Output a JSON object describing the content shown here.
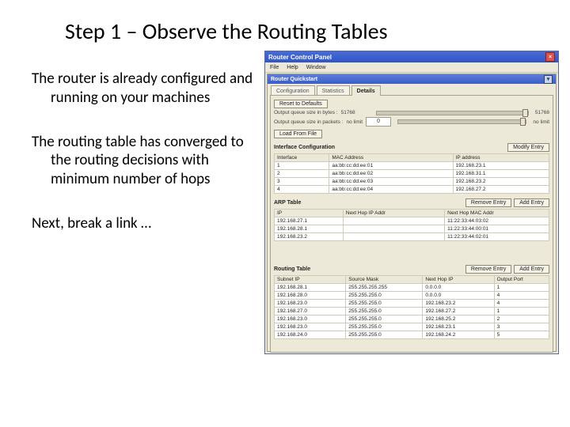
{
  "slide": {
    "title": "Step 1 – Observe the Routing Tables",
    "para1": "The router is already configured and running on your machines",
    "para2": "The routing table has converged to the routing decisions with minimum number of hops",
    "para3": "Next, break a link …"
  },
  "win": {
    "title": "Router Control Panel",
    "menu": {
      "file": "File",
      "help": "Help",
      "window": "Window"
    },
    "panel_title": "Router Quickstart",
    "tabs": {
      "t1": "Configuration",
      "t2": "Statistics",
      "t3": "Details"
    },
    "buttons": {
      "reset": "Reset to Defaults",
      "load": "Load From File",
      "modify": "Modify Entry",
      "remove": "Remove Entry",
      "add": "Add Entry"
    },
    "queue": {
      "label1": "Output queue size in bytes :",
      "val1": "51768",
      "right1": "51768",
      "label2": "Output queue size in packets :",
      "val2": "no limit",
      "right2": "no limit",
      "slider2_input": "0"
    },
    "iface": {
      "heading": "Interface Configuration",
      "h1": "Interface",
      "h2": "MAC Address",
      "h3": "IP address",
      "rows": [
        {
          "a": "1",
          "b": "aa:bb:cc:dd:ee:01",
          "c": "192.168.23.1"
        },
        {
          "a": "2",
          "b": "aa:bb:cc:dd:ee:02",
          "c": "192.168.31.1"
        },
        {
          "a": "3",
          "b": "aa:bb:cc:dd:ee:03",
          "c": "192.168.23.2"
        },
        {
          "a": "4",
          "b": "aa:bb:cc:dd:ee:04",
          "c": "192.168.27.2"
        }
      ]
    },
    "arp": {
      "heading": "ARP Table",
      "h1": "IP",
      "h2": "Next Hop IP Addr",
      "h3": "Next Hop MAC Addr",
      "rows": [
        {
          "a": "192.168.27.1",
          "b": "",
          "c": "11:22:33:44:03:02"
        },
        {
          "a": "192.168.28.1",
          "b": "",
          "c": "11:22:33:44:00:01"
        },
        {
          "a": "192.168.23.2",
          "b": "",
          "c": "11:22:33:44:02:01"
        }
      ]
    },
    "rt": {
      "heading": "Routing Table",
      "h1": "Subnet IP",
      "h2": "Source Mask",
      "h3": "Next Hop IP",
      "h4": "Output Port",
      "rows": [
        {
          "a": "192.168.28.1",
          "b": "255.255.255.255",
          "c": "0.0.0.0",
          "d": "1"
        },
        {
          "a": "192.168.28.0",
          "b": "255.255.255.0",
          "c": "0.0.0.0",
          "d": "4"
        },
        {
          "a": "192.168.23.0",
          "b": "255.255.255.0",
          "c": "192.168.23.2",
          "d": "4"
        },
        {
          "a": "192.168.27.0",
          "b": "255.255.255.0",
          "c": "192.168.27.2",
          "d": "1"
        },
        {
          "a": "192.168.23.0",
          "b": "255.255.255.0",
          "c": "192.168.25.2",
          "d": "2"
        },
        {
          "a": "192.168.23.0",
          "b": "255.255.255.0",
          "c": "192.168.23.1",
          "d": "3"
        },
        {
          "a": "192.168.24.0",
          "b": "255.255.255.0",
          "c": "192.168.24.2",
          "d": "5"
        }
      ]
    }
  }
}
